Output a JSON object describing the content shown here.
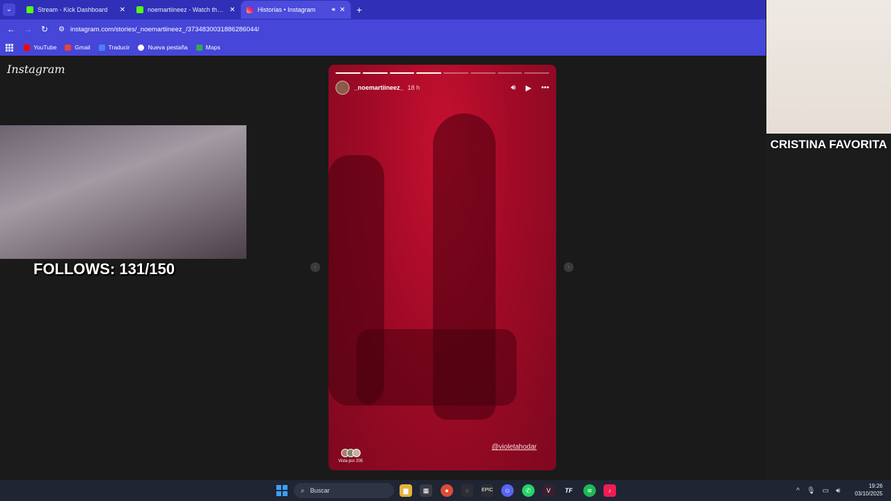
{
  "browser": {
    "tabs": [
      {
        "label": "Stream - Kick Dashboard",
        "icon": "kick-icon",
        "active": false
      },
      {
        "label": "noemartiineez - Watch the VOD",
        "icon": "kick-icon",
        "active": false
      },
      {
        "label": "Historias • Instagram",
        "icon": "instagram-icon",
        "active": true
      }
    ],
    "url": "instagram.com/stories/_noemartiineez_/3734830031886286044/",
    "bookmarks": [
      {
        "label": "YouTube",
        "color": "#ff0000"
      },
      {
        "label": "Gmail",
        "color": "#ea4335"
      },
      {
        "label": "Traducir",
        "color": "#4285f4"
      },
      {
        "label": "Nueva pestaña",
        "color": "#ffffff"
      },
      {
        "label": "Maps",
        "color": "#34a853"
      }
    ]
  },
  "instagram": {
    "logo": "Instagram",
    "story": {
      "username": "_noemartiineez_",
      "time": "18 h",
      "progress_segments_total": 8,
      "progress_segments_done": 4,
      "mention": "@violetahodar",
      "viewers_label": "Vista por 205"
    }
  },
  "overlays": {
    "follows": "FOLLOWS: 131/150",
    "cam_caption": "CRISTINA FAVORITA"
  },
  "taskbar": {
    "search_placeholder": "Buscar",
    "time": "19:26",
    "date": "03/10/2025"
  }
}
